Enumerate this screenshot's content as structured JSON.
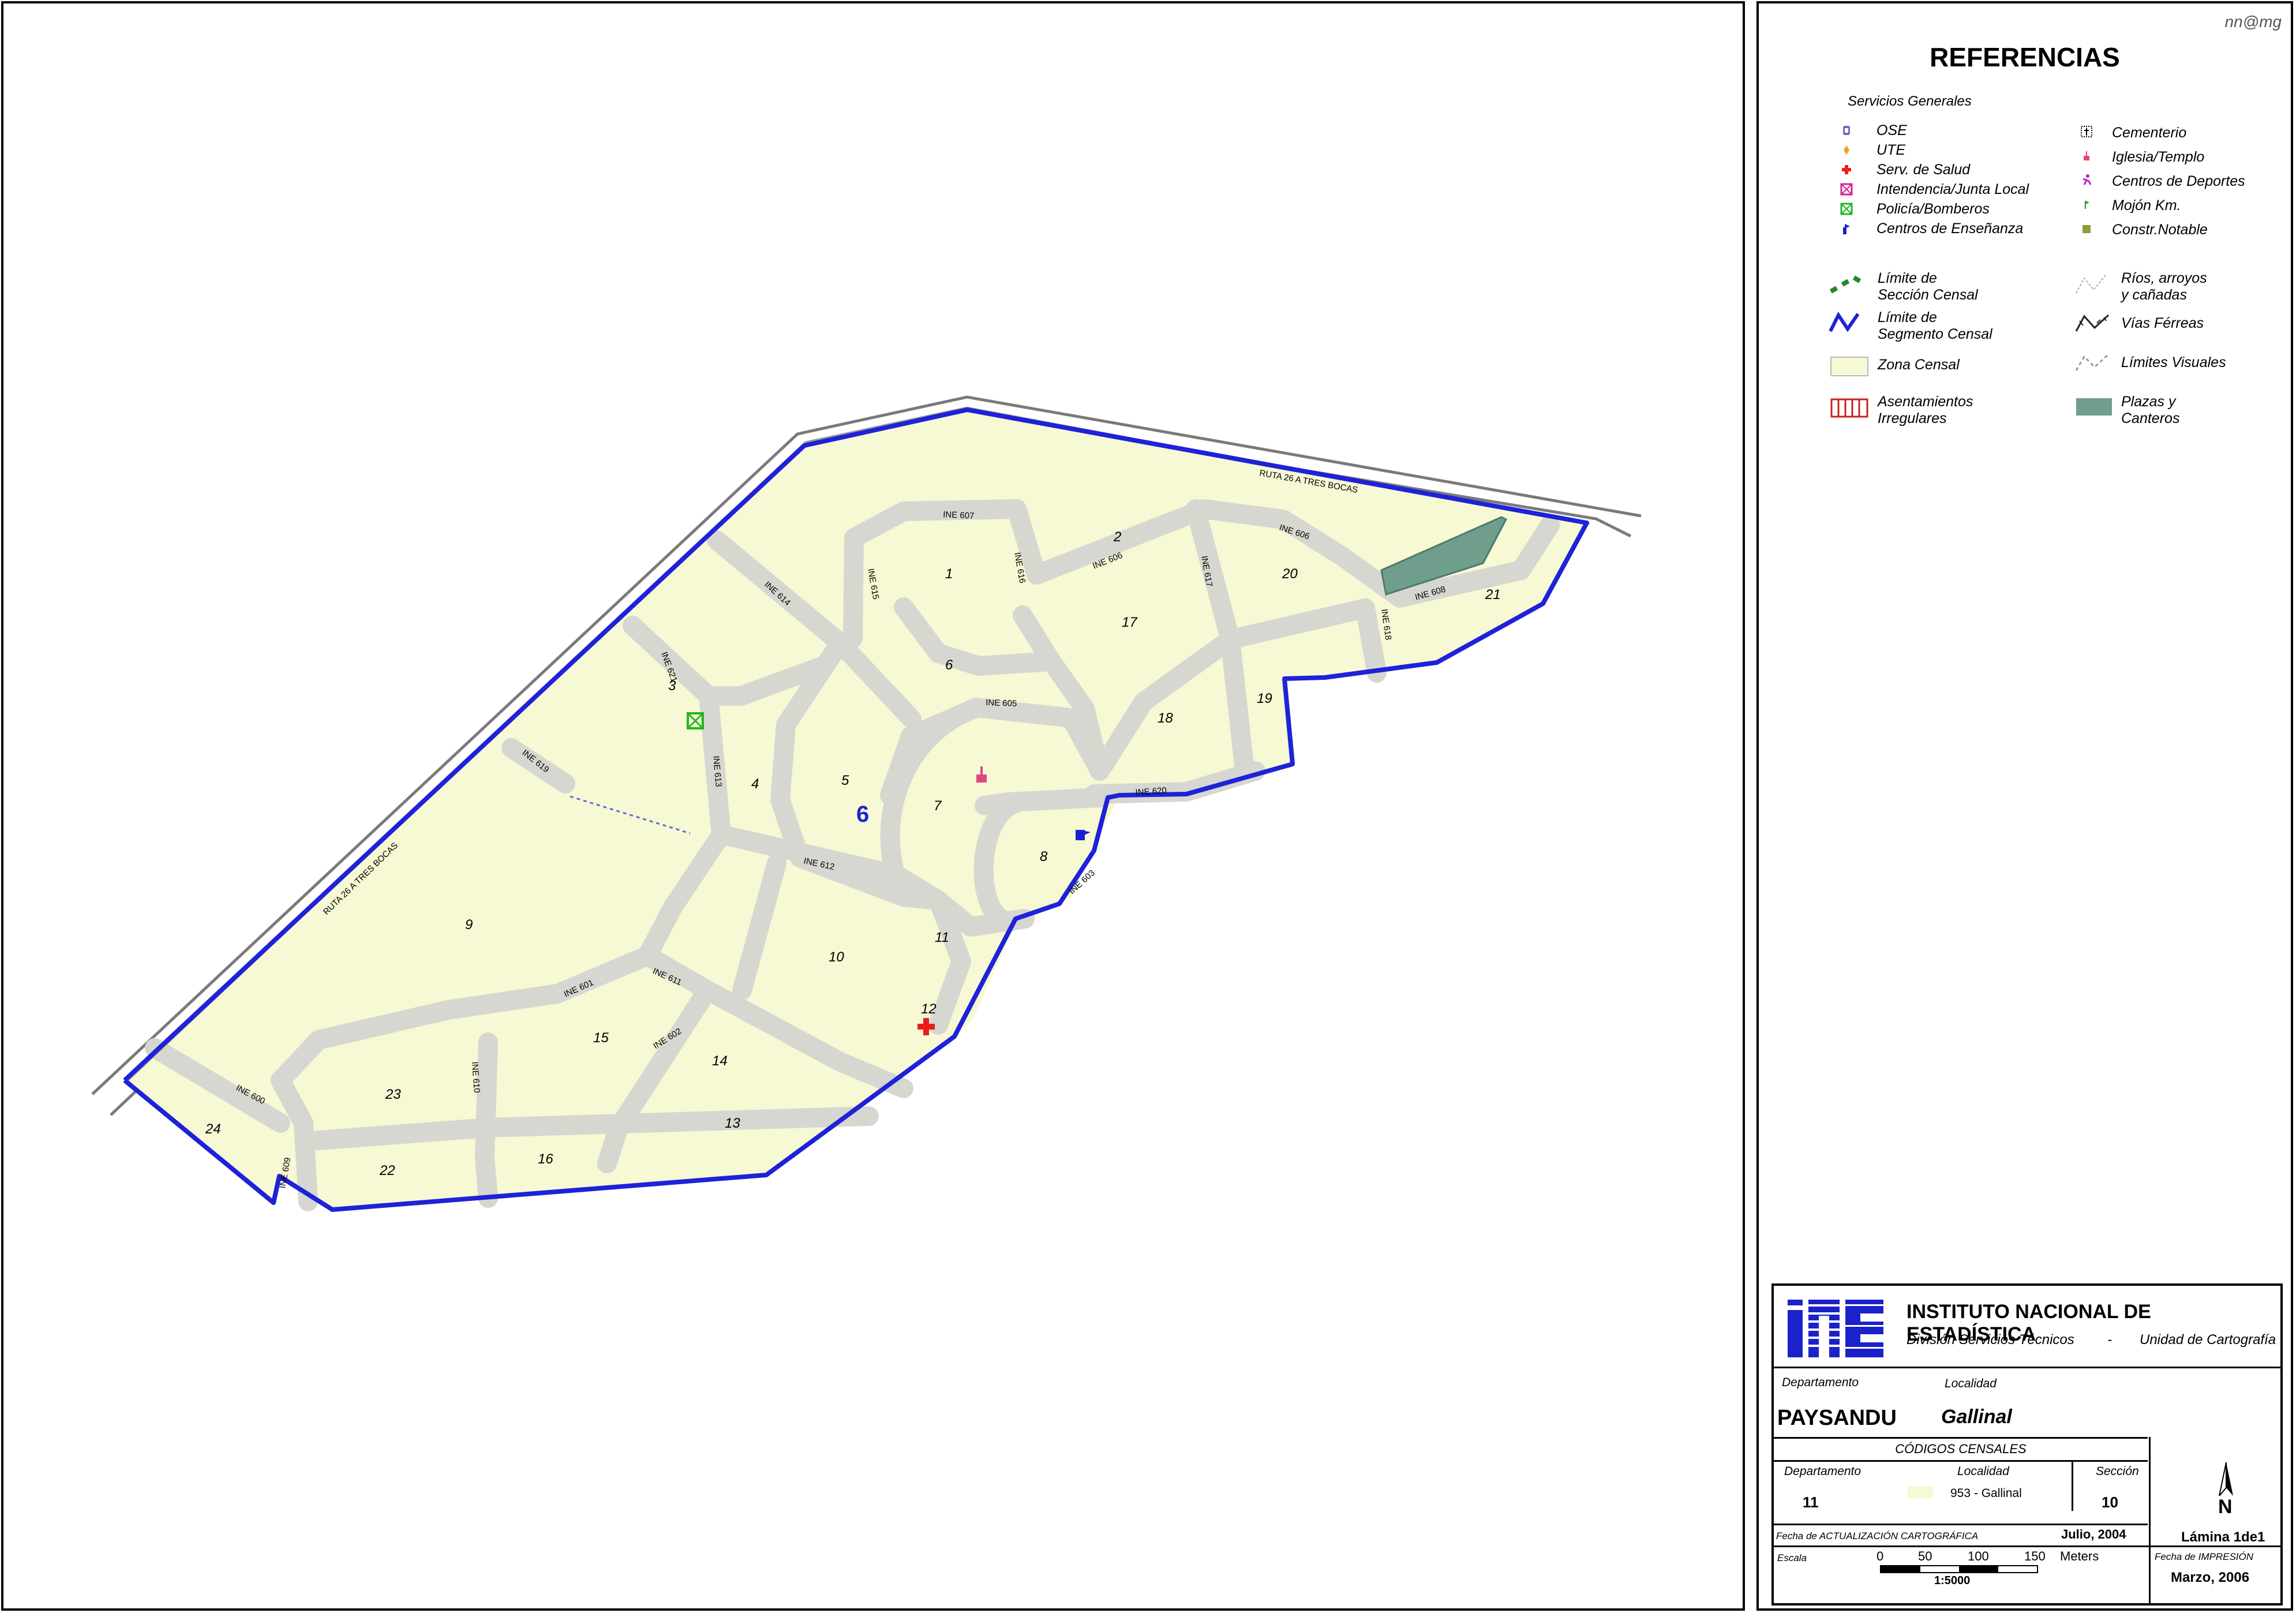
{
  "author_tag": "nn@mg",
  "map": {
    "segment_label": "6",
    "zone_labels": [
      "1",
      "2",
      "3",
      "4",
      "5",
      "6",
      "7",
      "8",
      "9",
      "10",
      "11",
      "12",
      "13",
      "14",
      "15",
      "16",
      "17",
      "18",
      "19",
      "20",
      "21",
      "22",
      "23",
      "24"
    ],
    "street_labels": {
      "ruta_top": "RUTA 26 A TRES BOCAS",
      "ruta_left": "RUTA 26 A TRES BOCAS",
      "ine607": "INE 607",
      "ine615": "INE 615",
      "ine616": "INE 616",
      "ine606a": "INE 606",
      "ine606b": "INE 606",
      "ine617": "INE 617",
      "ine608": "INE 608",
      "ine618": "INE 618",
      "ine614": "INE 614",
      "ine621": "INE 621",
      "ine619": "INE 619",
      "ine613": "INE 613",
      "ine605": "INE 605",
      "ine612": "INE 612",
      "ine620": "INE 620",
      "ine603": "INE 603",
      "ine611": "INE 611",
      "ine601": "INE 601",
      "ine602": "INE 602",
      "ine610": "INE 610",
      "ine600": "INE 600",
      "ine609": "INE 609"
    },
    "colors": {
      "zone": "#f7f8d4",
      "road": "#d6d6d0",
      "segment_line": "#1e22d8",
      "plaza": "#6f9e8c",
      "street_edge": "#808080"
    }
  },
  "legend": {
    "title": "REFERENCIAS",
    "group_title": "Servicios Generales",
    "left_items": [
      {
        "icon": "ose-icon",
        "label": "OSE"
      },
      {
        "icon": "ute-icon",
        "label": "UTE"
      },
      {
        "icon": "health-cross-icon",
        "label": "Serv. de Salud"
      },
      {
        "icon": "intendencia-icon",
        "label": "Intendencia/Junta Local"
      },
      {
        "icon": "police-icon",
        "label": "Policía/Bomberos"
      },
      {
        "icon": "school-flag-icon",
        "label": "Centros de Enseñanza"
      }
    ],
    "right_items": [
      {
        "icon": "cemetery-icon",
        "label": "Cementerio"
      },
      {
        "icon": "church-icon",
        "label": "Iglesia/Templo"
      },
      {
        "icon": "sports-icon",
        "label": "Centros de Deportes"
      },
      {
        "icon": "milestone-icon",
        "label": "Mojón Km."
      },
      {
        "icon": "notable-building-icon",
        "label": "Constr.Notable"
      }
    ],
    "lines_left": [
      {
        "icon": "census-section-limit-icon",
        "label": "Límite de\nSección Censal"
      },
      {
        "icon": "census-segment-limit-icon",
        "label": "Límite de\nSegmento Censal"
      },
      {
        "icon": "census-zone-icon",
        "label": "Zona Censal"
      },
      {
        "icon": "irregular-settlement-icon",
        "label": "Asentamientos\nIrregulares"
      }
    ],
    "lines_right": [
      {
        "icon": "river-icon",
        "label": "Ríos, arroyos\ny cañadas"
      },
      {
        "icon": "railway-icon",
        "label": "Vías Férreas"
      },
      {
        "icon": "visual-limit-icon",
        "label": "Límites  Visuales"
      },
      {
        "icon": "plaza-icon",
        "label": "Plazas y\nCanteros"
      }
    ]
  },
  "titleblock": {
    "logo_text": "INE",
    "institute": "INSTITUTO NACIONAL DE ESTADÍSTICA",
    "division": "División Servicios Técnicos",
    "separator": "-",
    "unit": "Unidad de Cartografía",
    "dept_label": "Departamento",
    "loc_label": "Localidad",
    "dept_name": "PAYSANDU",
    "loc_name": "Gallinal",
    "codes_title": "CÓDIGOS CENSALES",
    "code_dept_label": "Departamento",
    "code_loc_label": "Localidad",
    "code_sec_label": "Sección",
    "code_dept": "11",
    "code_loc": "953 - Gallinal",
    "code_sec": "10",
    "update_label": "Fecha de ACTUALIZACIÓN CARTOGRÁFICA",
    "update_date": "Julio, 2004",
    "sheet": "Lámina 1de1",
    "scale_label": "Escala",
    "scale_ticks": [
      "0",
      "50",
      "100",
      "150"
    ],
    "scale_unit": "Meters",
    "scale_ratio": "1:5000",
    "print_label": "Fecha de IMPRESIÓN",
    "print_date": "Marzo, 2006",
    "north": "N"
  }
}
